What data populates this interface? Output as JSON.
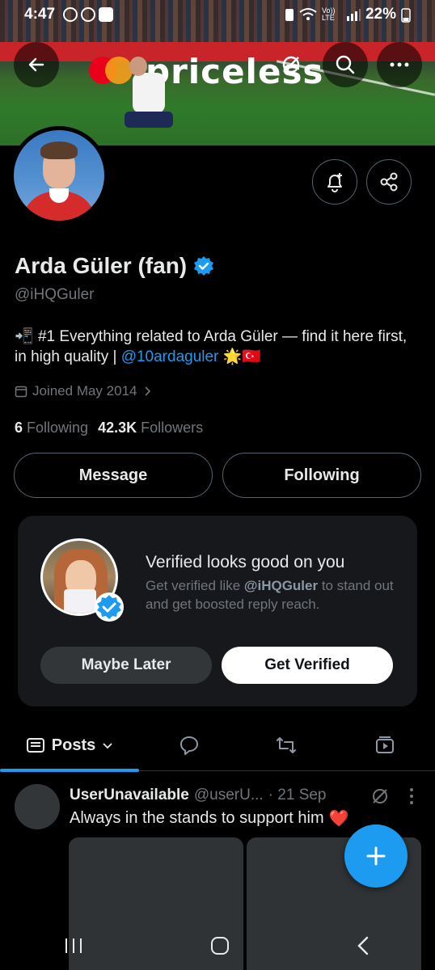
{
  "status_bar": {
    "time": "4:47",
    "network": "Vo)) LTE",
    "battery": "22%"
  },
  "banner": {
    "ad_text": "priceless"
  },
  "profile": {
    "name": "Arda Güler (fan)",
    "handle": "@iHQGuler",
    "bio_emoji_start": "📲",
    "bio_text": " #1 Everything related to Arda Güler — find it here first, in high quality | ",
    "bio_link": "@10ardaguler",
    "bio_emoji_end": " 🌟🇹🇷",
    "joined": "Joined May 2014",
    "following_count": "6",
    "following_label": "Following",
    "followers_count": "42.3K",
    "followers_label": "Followers"
  },
  "actions": {
    "message": "Message",
    "following": "Following"
  },
  "verified_card": {
    "title": "Verified looks good on you",
    "desc_prefix": "Get verified like ",
    "desc_handle": "@iHQGuler",
    "desc_suffix": " to stand out and get boosted reply reach.",
    "maybe_later": "Maybe Later",
    "get_verified": "Get Verified"
  },
  "tabs": {
    "posts": "Posts"
  },
  "post": {
    "author": "UserUnavailable",
    "handle": "@userU...",
    "date": "· 21 Sep",
    "text": "Always in the stands to support him",
    "emoji": "❤️"
  },
  "colors": {
    "accent": "#1d9bf0",
    "background": "#000000",
    "card": "#16181c"
  }
}
